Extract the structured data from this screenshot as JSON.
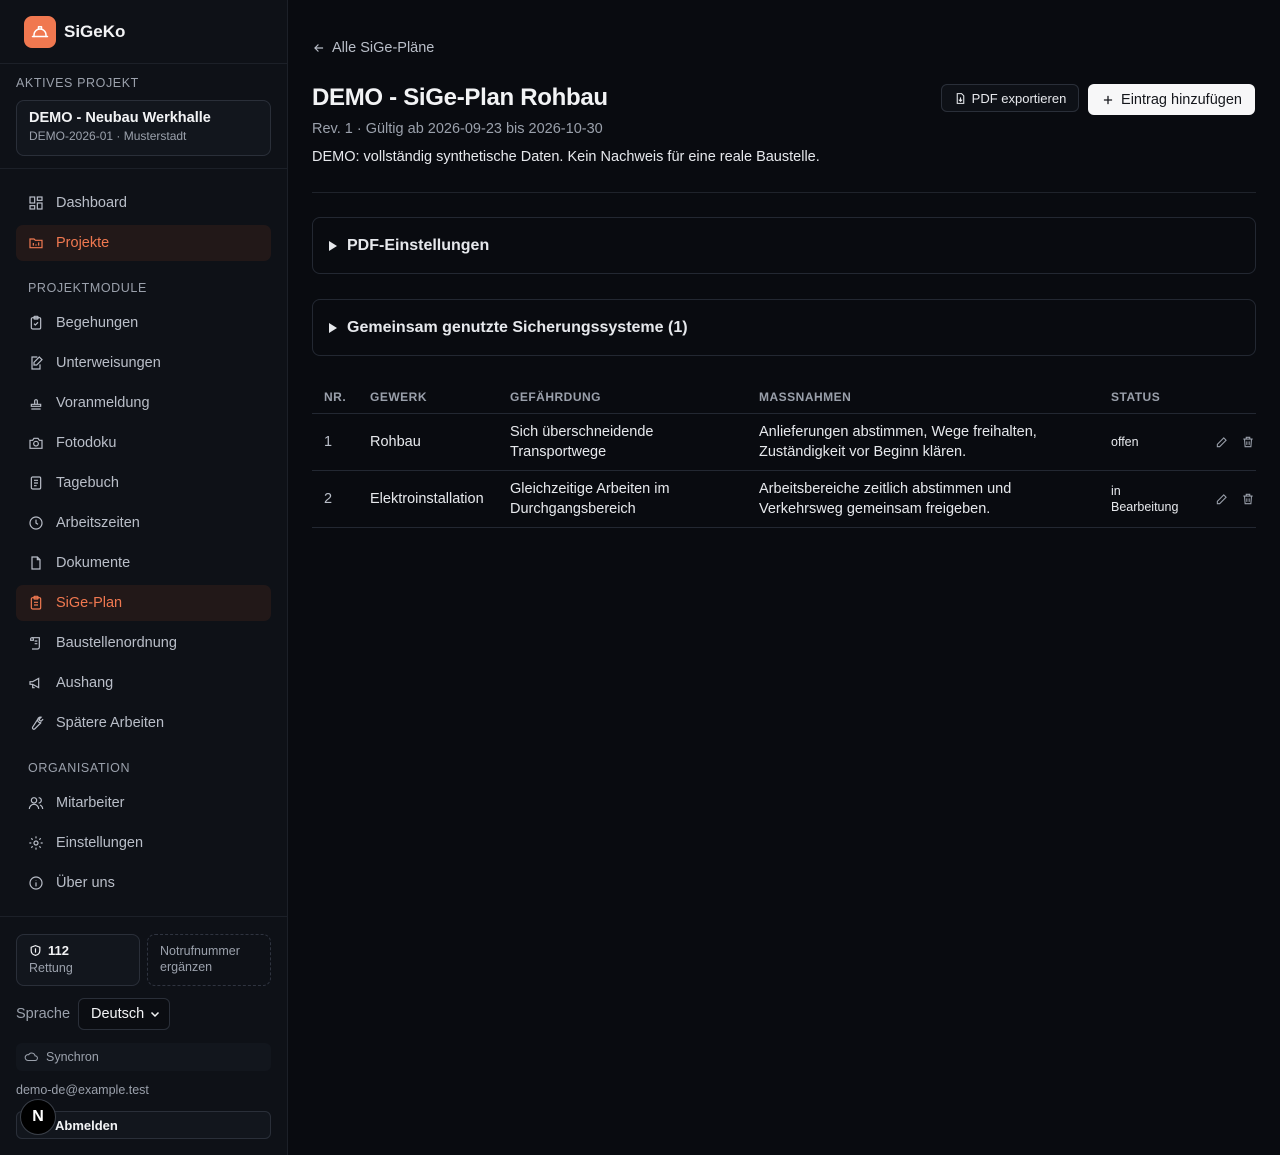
{
  "brand": {
    "name": "SiGeKo"
  },
  "active_project": {
    "label": "Aktives Projekt",
    "name": "DEMO - Neubau Werkhalle",
    "sub": "DEMO-2026-01 · Musterstadt"
  },
  "nav_top": [
    {
      "label": "Dashboard",
      "icon": "grid-icon"
    },
    {
      "label": "Projekte",
      "icon": "folder-icon"
    }
  ],
  "group_modules": {
    "label": "Projektmodule"
  },
  "nav_modules": [
    {
      "label": "Begehungen",
      "icon": "clipboard-check-icon"
    },
    {
      "label": "Unterweisungen",
      "icon": "edit-document-icon"
    },
    {
      "label": "Voranmeldung",
      "icon": "stamp-icon"
    },
    {
      "label": "Fotodoku",
      "icon": "camera-icon"
    },
    {
      "label": "Tagebuch",
      "icon": "notebook-icon"
    },
    {
      "label": "Arbeitszeiten",
      "icon": "clock-icon"
    },
    {
      "label": "Dokumente",
      "icon": "file-icon"
    },
    {
      "label": "SiGe-Plan",
      "icon": "clipboard-list-icon"
    },
    {
      "label": "Baustellenordnung",
      "icon": "scroll-icon"
    },
    {
      "label": "Aushang",
      "icon": "megaphone-icon"
    },
    {
      "label": "Spätere Arbeiten",
      "icon": "wrench-icon"
    }
  ],
  "group_org": {
    "label": "Organisation"
  },
  "nav_org": [
    {
      "label": "Mitarbeiter",
      "icon": "users-icon"
    },
    {
      "label": "Einstellungen",
      "icon": "gear-icon"
    },
    {
      "label": "Über uns",
      "icon": "info-icon"
    }
  ],
  "emergency": {
    "number": "112",
    "number_label": "Rettung",
    "missing": "Notrufnummer ergänzen"
  },
  "language": {
    "label": "Sprache",
    "value": "Deutsch"
  },
  "sync": {
    "label": "Synchron"
  },
  "user": {
    "email": "demo-de@example.test",
    "logout": "Abmelden",
    "badge": "N"
  },
  "page": {
    "back_link": "Alle SiGe-Pläne",
    "title": "DEMO - SiGe-Plan Rohbau",
    "revision": "Rev. 1 · Gültig ab 2026-09-23 bis 2026-10-30",
    "note": "DEMO: vollständig synthetische Daten. Kein Nachweis für eine reale Baustelle.",
    "btn_pdf": "PDF exportieren",
    "btn_add": "Eintrag hinzufügen"
  },
  "sections": [
    {
      "label": "PDF-Einstellungen"
    },
    {
      "label": "Gemeinsam genutzte Sicherungssysteme (1)"
    }
  ],
  "table": {
    "headers": [
      "Nr.",
      "Gewerk",
      "Gefährdung",
      "Maßnahmen",
      "Status"
    ],
    "rows": [
      {
        "nr": "1",
        "gewerk": "Rohbau",
        "gefaehrdung": "Sich überschneidende Transportwege",
        "massnahmen": "Anlieferungen abstimmen, Wege freihalten, Zuständigkeit vor Beginn klären.",
        "status": "offen"
      },
      {
        "nr": "2",
        "gewerk": "Elektroinstallation",
        "gefaehrdung": "Gleichzeitige Arbeiten im Durchgangsbereich",
        "massnahmen": "Arbeitsbereiche zeitlich abstimmen und Verkehrsweg gemeinsam freigeben.",
        "status": "in Bearbeitung"
      }
    ]
  },
  "colors": {
    "accent": "#f07850",
    "active_bg": "#221818",
    "background": "#090b10",
    "sidebar": "#0e1117"
  }
}
